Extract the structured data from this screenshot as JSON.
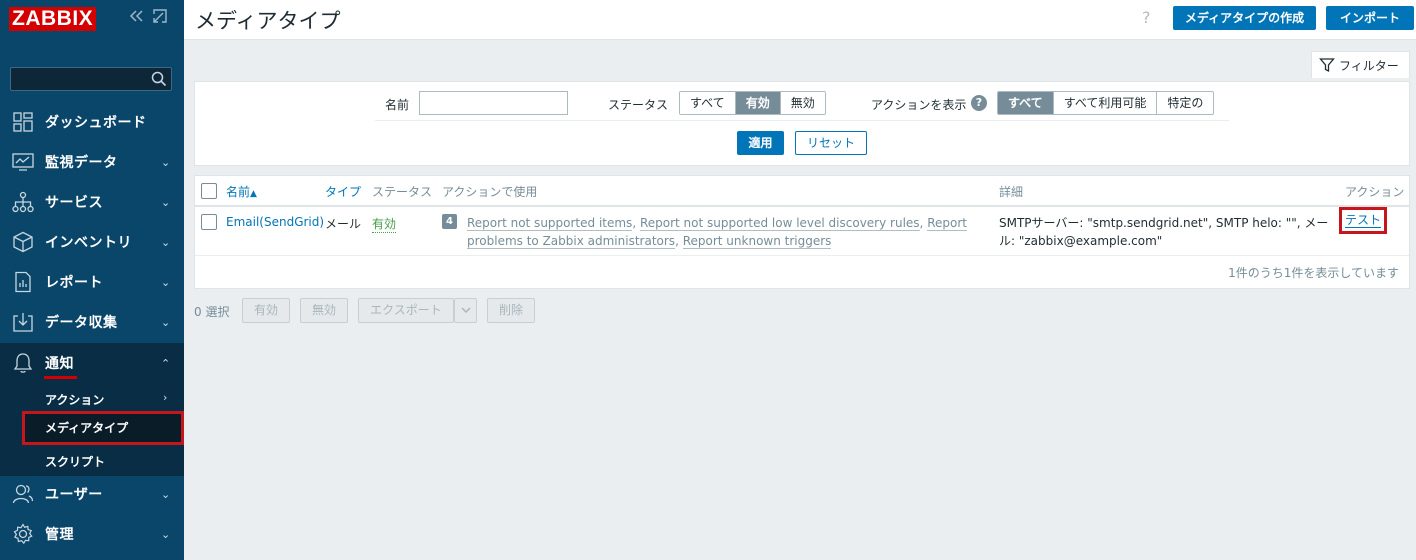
{
  "app": {
    "logo": "ZABBIX",
    "collapse_icon": "double-chevron-left-icon",
    "kiosk_icon": "expand-icon"
  },
  "sidebar": {
    "search_placeholder": "",
    "menu": [
      {
        "label": "ダッシュボード",
        "icon": "dashboard-icon"
      },
      {
        "label": "監視データ",
        "icon": "monitoring-icon"
      },
      {
        "label": "サービス",
        "icon": "services-icon"
      },
      {
        "label": "インベントリ",
        "icon": "inventory-icon"
      },
      {
        "label": "レポート",
        "icon": "reports-icon"
      },
      {
        "label": "データ収集",
        "icon": "data-collection-icon"
      },
      {
        "label": "通知",
        "icon": "bell-icon"
      },
      {
        "label": "ユーザー",
        "icon": "users-icon"
      },
      {
        "label": "管理",
        "icon": "gear-icon"
      }
    ],
    "submenu": [
      {
        "label": "アクション"
      },
      {
        "label": "メディアタイプ"
      },
      {
        "label": "スクリプト"
      }
    ]
  },
  "header": {
    "title": "メディアタイプ",
    "help": "?",
    "create_button": "メディアタイプの作成",
    "import_button": "インポート"
  },
  "filter": {
    "tab_label": "フィルター",
    "name_label": "名前",
    "name_value": "",
    "status_label": "ステータス",
    "status_options": [
      "すべて",
      "有効",
      "無効"
    ],
    "status_selected": "有効",
    "action_label": "アクションを表示",
    "action_help": "?",
    "action_options": [
      "すべて",
      "すべて利用可能",
      "特定の"
    ],
    "action_selected": "すべて",
    "apply": "適用",
    "reset": "リセット"
  },
  "table": {
    "columns": {
      "name": "名前",
      "sort_indicator": "▲",
      "type": "タイプ",
      "status": "ステータス",
      "used_in_actions": "アクションで使用",
      "details": "詳細",
      "actions": "アクション"
    },
    "rows": [
      {
        "name": "Email(SendGrid)",
        "type": "メール",
        "status": "有効",
        "action_count": "4",
        "actions": [
          "Report not supported items",
          "Report not supported low level discovery rules",
          "Report problems to Zabbix administrators",
          "Report unknown triggers"
        ],
        "details": "SMTPサーバー: \"smtp.sendgrid.net\", SMTP helo: \"\", メール: \"zabbix@example.com\"",
        "test": "テスト"
      }
    ],
    "paging": "1件のうち1件を表示しています"
  },
  "bulk": {
    "selected": "0 選択",
    "enable": "有効",
    "disable": "無効",
    "export": "エクスポート",
    "delete": "削除"
  }
}
